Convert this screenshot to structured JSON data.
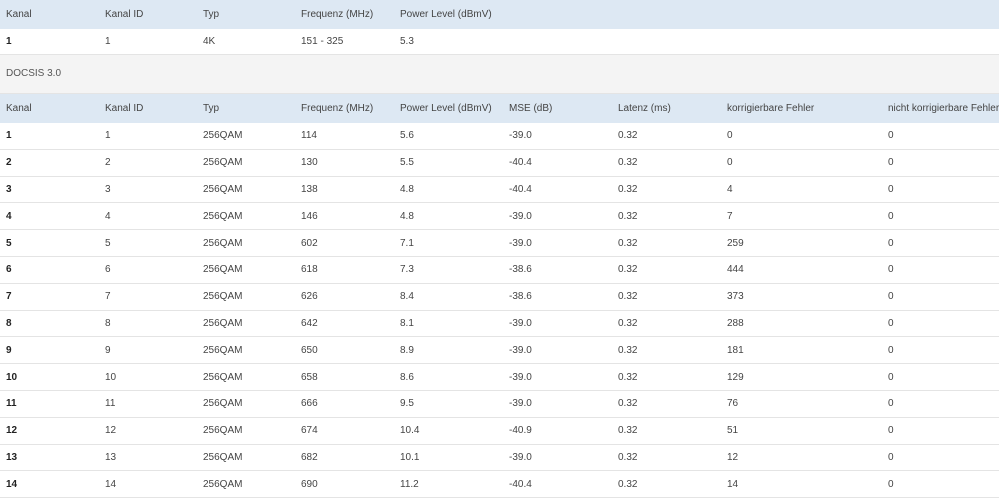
{
  "upstream_ofdm": {
    "headers": [
      "Kanal",
      "Kanal ID",
      "Typ",
      "Frequenz (MHz)",
      "Power Level (dBmV)"
    ],
    "rows": [
      [
        "1",
        "1",
        "4K",
        "151 - 325",
        "5.3"
      ]
    ]
  },
  "section_title": "DOCSIS 3.0",
  "docsis30": {
    "headers": [
      "Kanal",
      "Kanal ID",
      "Typ",
      "Frequenz (MHz)",
      "Power Level (dBmV)",
      "MSE (dB)",
      "Latenz (ms)",
      "korrigierbare Fehler",
      "nicht korrigierbare Fehler"
    ],
    "rows": [
      [
        "1",
        "1",
        "256QAM",
        "114",
        "5.6",
        "-39.0",
        "0.32",
        "0",
        "0"
      ],
      [
        "2",
        "2",
        "256QAM",
        "130",
        "5.5",
        "-40.4",
        "0.32",
        "0",
        "0"
      ],
      [
        "3",
        "3",
        "256QAM",
        "138",
        "4.8",
        "-40.4",
        "0.32",
        "4",
        "0"
      ],
      [
        "4",
        "4",
        "256QAM",
        "146",
        "4.8",
        "-39.0",
        "0.32",
        "7",
        "0"
      ],
      [
        "5",
        "5",
        "256QAM",
        "602",
        "7.1",
        "-39.0",
        "0.32",
        "259",
        "0"
      ],
      [
        "6",
        "6",
        "256QAM",
        "618",
        "7.3",
        "-38.6",
        "0.32",
        "444",
        "0"
      ],
      [
        "7",
        "7",
        "256QAM",
        "626",
        "8.4",
        "-38.6",
        "0.32",
        "373",
        "0"
      ],
      [
        "8",
        "8",
        "256QAM",
        "642",
        "8.1",
        "-39.0",
        "0.32",
        "288",
        "0"
      ],
      [
        "9",
        "9",
        "256QAM",
        "650",
        "8.9",
        "-39.0",
        "0.32",
        "181",
        "0"
      ],
      [
        "10",
        "10",
        "256QAM",
        "658",
        "8.6",
        "-39.0",
        "0.32",
        "129",
        "0"
      ],
      [
        "11",
        "11",
        "256QAM",
        "666",
        "9.5",
        "-39.0",
        "0.32",
        "76",
        "0"
      ],
      [
        "12",
        "12",
        "256QAM",
        "674",
        "10.4",
        "-40.9",
        "0.32",
        "51",
        "0"
      ],
      [
        "13",
        "13",
        "256QAM",
        "682",
        "10.1",
        "-39.0",
        "0.32",
        "12",
        "0"
      ],
      [
        "14",
        "14",
        "256QAM",
        "690",
        "11.2",
        "-40.4",
        "0.32",
        "14",
        "0"
      ]
    ]
  }
}
